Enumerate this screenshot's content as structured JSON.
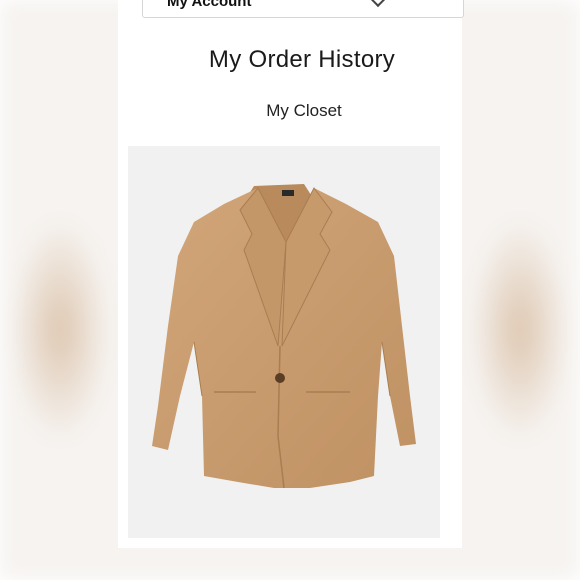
{
  "header": {
    "account_label": "My Account"
  },
  "menu": {
    "order_history": "My Order History",
    "closet": "My Closet"
  },
  "product": {
    "image_icon": "blazer-product-image",
    "color": "#C99C6E"
  }
}
